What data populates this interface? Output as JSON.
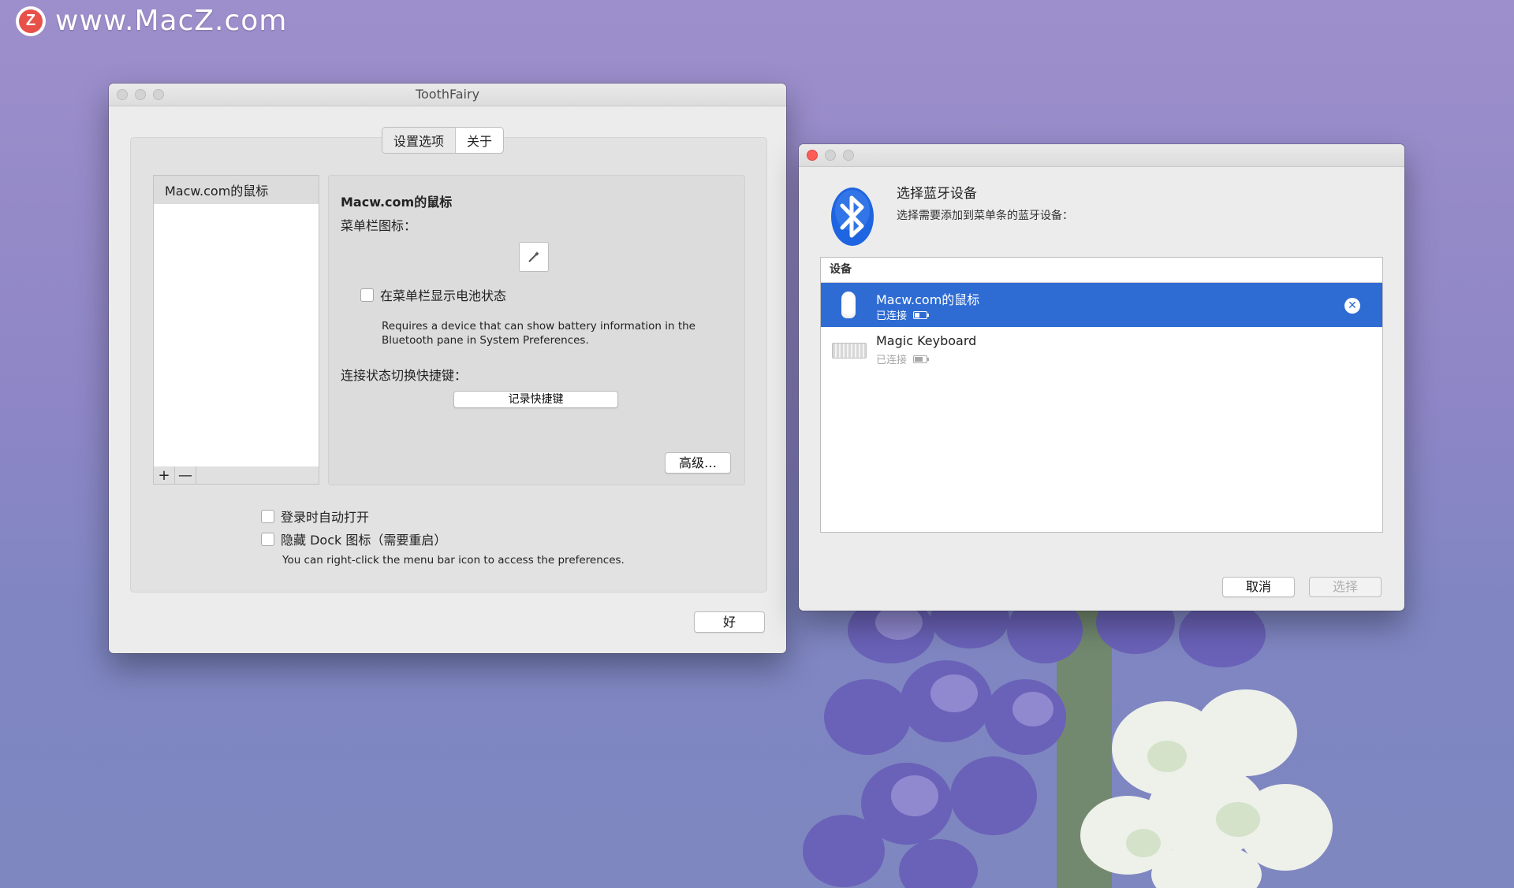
{
  "watermark": {
    "logo_letter": "Z",
    "text": "www.MacZ.com"
  },
  "toothfairy_window": {
    "title": "ToothFairy",
    "tabs": [
      {
        "label": "设置选项",
        "active": true
      },
      {
        "label": "关于",
        "active": false
      }
    ],
    "device_list": {
      "items": [
        "Macw.com的鼠标"
      ],
      "add_label": "+",
      "remove_label": "—"
    },
    "detail": {
      "device_name": "Macw.com的鼠标",
      "menubar_icon_label": "菜单栏图标：",
      "icon_glyph": "magic-wand-icon",
      "show_battery_label": "在菜单栏显示电池状态",
      "show_battery_checked": false,
      "battery_note": "Requires a device that can show battery information in the Bluetooth pane in System Preferences.",
      "shortcut_label": "连接状态切换快捷键：",
      "record_shortcut_button": "记录快捷键",
      "advanced_button": "高级…"
    },
    "launch_at_login_label": "登录时自动打开",
    "launch_at_login_checked": false,
    "hide_dock_label": "隐藏 Dock 图标（需要重启）",
    "hide_dock_checked": false,
    "hide_dock_note": "You can right-click the menu bar icon to access the preferences.",
    "ok_button": "好"
  },
  "bluetooth_window": {
    "heading": "选择蓝牙设备",
    "subheading": "选择需要添加到菜单条的蓝牙设备：",
    "column_header": "设备",
    "devices": [
      {
        "name": "Macw.com的鼠标",
        "status": "已连接",
        "selected": true,
        "icon": "mouse-icon"
      },
      {
        "name": "Magic Keyboard",
        "status": "已连接",
        "selected": false,
        "icon": "keyboard-icon"
      }
    ],
    "cancel_button": "取消",
    "select_button": "选择",
    "colors": {
      "selection": "#2e6cd4",
      "bluetooth_blue": "#1f64e0",
      "close_red": "#fc5d57"
    }
  }
}
